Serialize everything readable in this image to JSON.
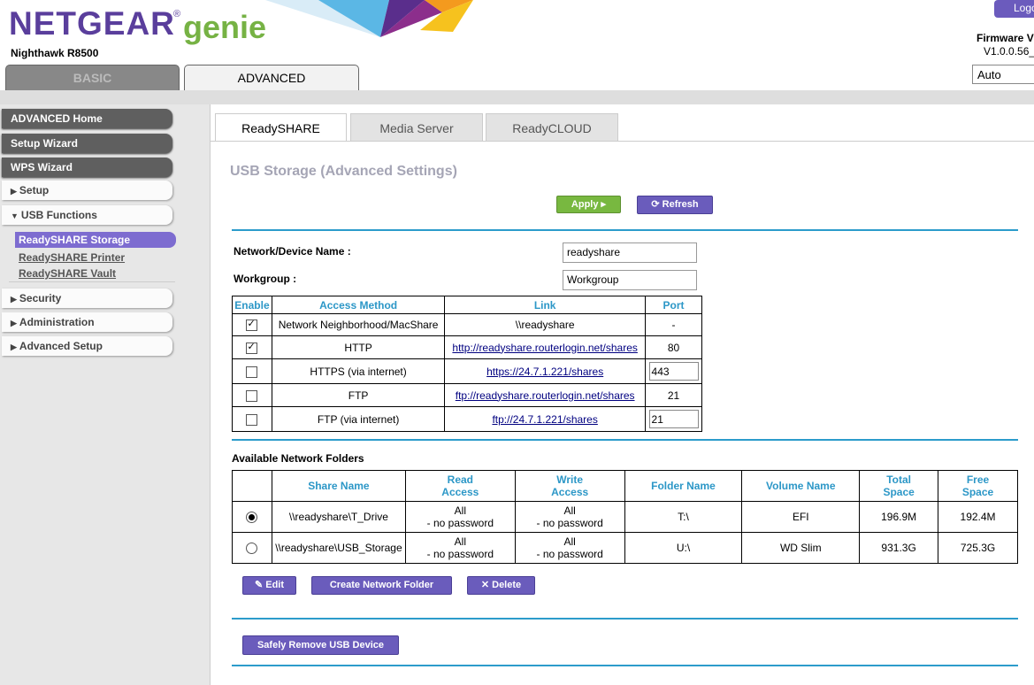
{
  "header": {
    "brand": "NETGEAR",
    "product": "genie",
    "model": "Nighthawk R8500",
    "logout_label": "Logo",
    "firmware_label": "Firmware V",
    "firmware_version": "V1.0.0.56_",
    "language": "Auto"
  },
  "main_tabs": {
    "basic": "BASIC",
    "advanced": "ADVANCED"
  },
  "nav": {
    "advanced_home": "ADVANCED Home",
    "setup_wizard": "Setup Wizard",
    "wps_wizard": "WPS Wizard",
    "setup": "Setup",
    "usb_functions": "USB Functions",
    "sub_storage": "ReadySHARE Storage",
    "sub_printer": "ReadySHARE Printer",
    "sub_vault": "ReadySHARE Vault",
    "security": "Security",
    "administration": "Administration",
    "advanced_setup": "Advanced Setup"
  },
  "content_tabs": {
    "readyshare": "ReadySHARE",
    "media": "Media Server",
    "cloud": "ReadyCLOUD"
  },
  "page_title": "USB Storage (Advanced Settings)",
  "buttons": {
    "apply": "Apply ▸",
    "refresh": "Refresh",
    "edit": "Edit",
    "create": "Create Network Folder",
    "delete": "Delete",
    "remove": "Safely Remove USB Device"
  },
  "device": {
    "name_label": "Network/Device Name :",
    "name_value": "readyshare",
    "workgroup_label": "Workgroup :",
    "workgroup_value": "Workgroup"
  },
  "access_table": {
    "headers": {
      "enable": "Enable",
      "method": "Access Method",
      "link": "Link",
      "port": "Port"
    },
    "rows": [
      {
        "enabled": true,
        "method": "Network Neighborhood/MacShare",
        "link": "\\\\readyshare",
        "port": "-"
      },
      {
        "enabled": true,
        "method": "HTTP",
        "link": "http://readyshare.routerlogin.net/shares",
        "port": "80"
      },
      {
        "enabled": false,
        "method": "HTTPS (via internet)",
        "link": "https://24.7.1.221/shares",
        "port": "443"
      },
      {
        "enabled": false,
        "method": "FTP",
        "link": "ftp://readyshare.routerlogin.net/shares",
        "port": "21"
      },
      {
        "enabled": false,
        "method": "FTP (via internet)",
        "link": "ftp://24.7.1.221/shares",
        "port": "21"
      }
    ]
  },
  "folders": {
    "title": "Available Network Folders",
    "headers": {
      "share": "Share Name",
      "read": "Read Access",
      "write": "Write Access",
      "folder": "Folder Name",
      "volume": "Volume Name",
      "total": "Total Space",
      "free": "Free Space"
    },
    "read_hdr": [
      "Read",
      "Access"
    ],
    "write_hdr": [
      "Write",
      "Access"
    ],
    "total_hdr": [
      "Total",
      "Space"
    ],
    "free_hdr": [
      "Free",
      "Space"
    ],
    "rows": [
      {
        "selected": true,
        "share": "\\\\readyshare\\T_Drive",
        "read1": "All",
        "read2": "- no password",
        "write1": "All",
        "write2": "- no password",
        "folder": "T:\\",
        "volume": "EFI",
        "total": "196.9M",
        "free": "192.4M"
      },
      {
        "selected": false,
        "share": "\\\\readyshare\\USB_Storage",
        "read1": "All",
        "read2": "- no password",
        "write1": "All",
        "write2": "- no password",
        "folder": "U:\\",
        "volume": "WD Slim",
        "total": "931.3G",
        "free": "725.3G"
      }
    ]
  },
  "colors": {
    "brand_purple": "#5a3e9c",
    "genie_green": "#76b244",
    "accent_blue": "#2c9ccb",
    "button_purple": "#6a5cbc",
    "apply_green": "#78b840"
  }
}
